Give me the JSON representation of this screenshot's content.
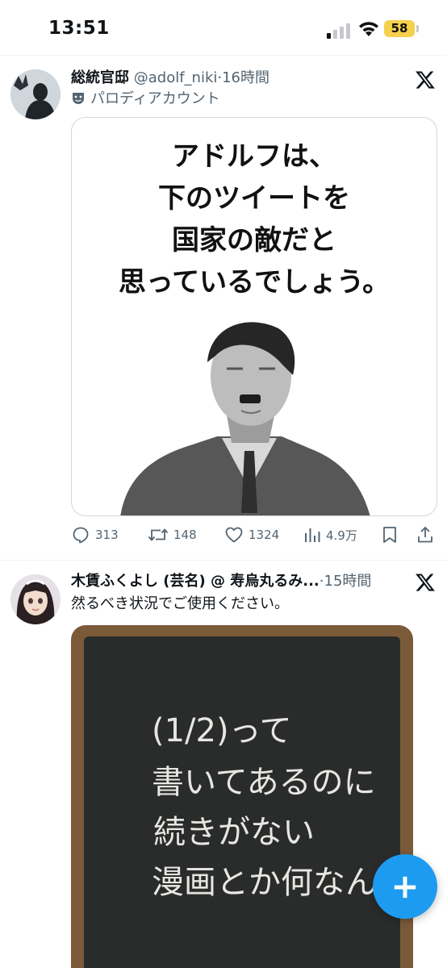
{
  "status_bar": {
    "time": "13:51",
    "battery_level": "58",
    "battery_color": "#f5d04d"
  },
  "tweet1": {
    "display_name": "総統官邸",
    "handle": "@adolf_niki",
    "separator": "·",
    "time": "16時間",
    "parody_label": "パロディアカウント",
    "poster_lines": [
      "アドルフは、",
      "下のツイートを",
      "国家の敵だと",
      "思っているでしょう。"
    ],
    "stats": {
      "replies": "313",
      "retweets": "148",
      "likes": "1324",
      "views": "4.9万"
    }
  },
  "tweet2": {
    "display_name": "木賃ふくよし (芸名) @ 寿烏丸るみ...",
    "separator": "·",
    "time": "15時間",
    "text": "然るべき状況でご使用ください。",
    "chalk_lines": [
      "(1/2)って",
      "書いてあるのに",
      "続きがない",
      "漫画とか何なん?"
    ]
  },
  "fab": {
    "symbol": "+"
  },
  "colors": {
    "accent": "#1d9bf0",
    "secondary_text": "#536471",
    "primary_text": "#0f1419"
  }
}
